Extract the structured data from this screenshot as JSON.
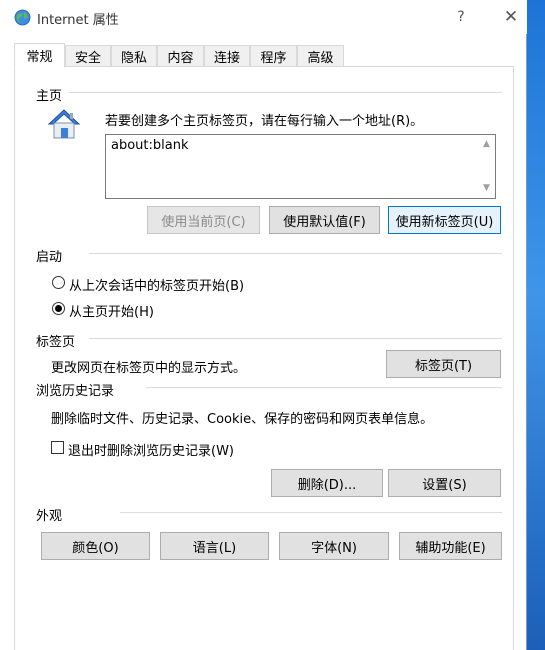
{
  "window": {
    "title": "Internet 属性",
    "help": "?",
    "close": "✕"
  },
  "tabs": [
    "常规",
    "安全",
    "隐私",
    "内容",
    "连接",
    "程序",
    "高级"
  ],
  "homepage": {
    "group_label": "主页",
    "instruction": "若要创建多个主页标签页，请在每行输入一个地址(R)。",
    "value": "about:blank",
    "use_current_button": "使用当前页(C)",
    "use_default_button": "使用默认值(F)",
    "use_new_tab_button": "使用新标签页(U)"
  },
  "startup": {
    "group_label": "启动",
    "option_last_session": "从上次会话中的标签页开始(B)",
    "option_home_page": "从主页开始(H)",
    "selected": "home_page"
  },
  "tabs_section": {
    "group_label": "标签页",
    "description": "更改网页在标签页中的显示方式。",
    "button": "标签页(T)"
  },
  "history": {
    "group_label": "浏览历史记录",
    "description": "删除临时文件、历史记录、Cookie、保存的密码和网页表单信息。",
    "checkbox_label": "退出时删除浏览历史记录(W)",
    "checkbox_checked": false,
    "delete_button": "删除(D)...",
    "settings_button": "设置(S)"
  },
  "appearance": {
    "group_label": "外观",
    "colors_button": "颜色(O)",
    "languages_button": "语言(L)",
    "fonts_button": "字体(N)",
    "accessibility_button": "辅助功能(E)"
  },
  "colors": {
    "accent": "#0078d7",
    "desktop": "#2b7fd6"
  }
}
